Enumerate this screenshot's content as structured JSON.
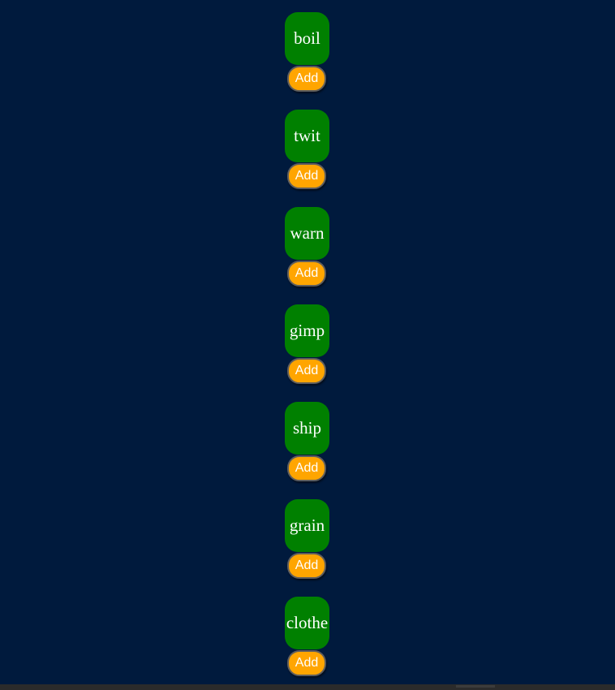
{
  "colors": {
    "background": "#001a3d",
    "tile": "#008000",
    "add_button": "#ffa500",
    "text": "#ffffff"
  },
  "items": [
    {
      "word": "boil",
      "button_label": "Add"
    },
    {
      "word": "twit",
      "button_label": "Add"
    },
    {
      "word": "warn",
      "button_label": "Add"
    },
    {
      "word": "gimp",
      "button_label": "Add"
    },
    {
      "word": "ship",
      "button_label": "Add"
    },
    {
      "word": "grain",
      "button_label": "Add"
    },
    {
      "word": "clothe",
      "button_label": "Add"
    }
  ]
}
